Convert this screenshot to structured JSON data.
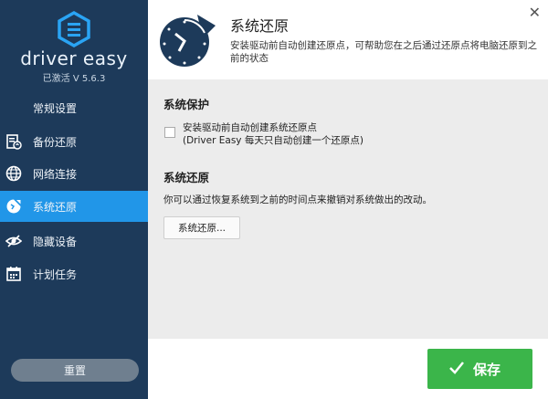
{
  "app": {
    "brand": "driver easy",
    "version": "已激活 V 5.6.3"
  },
  "sidebar": {
    "items": [
      {
        "label": "常规设置",
        "icon": "gear-icon"
      },
      {
        "label": "备份还原",
        "icon": "backup-icon"
      },
      {
        "label": "网络连接",
        "icon": "globe-icon"
      },
      {
        "label": "系统还原",
        "icon": "system-restore-icon",
        "active": true
      },
      {
        "label": "隐藏设备",
        "icon": "hidden-eye-icon"
      },
      {
        "label": "计划任务",
        "icon": "calendar-icon"
      }
    ],
    "reset_label": "重置"
  },
  "header": {
    "title": "系统还原",
    "description": "安装驱动前自动创建还原点，可帮助您在之后通过还原点将电脑还原到之前的状态"
  },
  "protection": {
    "title": "系统保护",
    "checkbox_line1": "安装驱动前自动创建系统还原点",
    "checkbox_line2": "(Driver Easy 每天只自动创建一个还原点)",
    "checked": false
  },
  "restore": {
    "title": "系统还原",
    "description": "你可以通过恢复系统到之前的时间点来撤销对系统做出的改动。",
    "button_label": "系统还原..."
  },
  "footer": {
    "save_label": "保存"
  },
  "colors": {
    "sidebar_bg": "#1d3a5a",
    "active_item": "#2196e8",
    "save_button": "#3bb54a",
    "content_bg": "#ececec"
  }
}
